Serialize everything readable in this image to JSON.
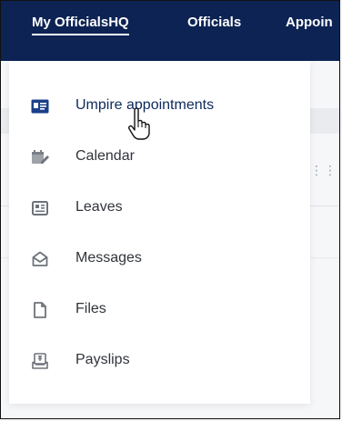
{
  "topnav": {
    "items": [
      {
        "label": "My OfficialsHQ"
      },
      {
        "label": "Officials"
      },
      {
        "label": "Appoin"
      }
    ]
  },
  "menu": {
    "items": [
      {
        "label": "Umpire appointments",
        "icon": "id-card-icon"
      },
      {
        "label": "Calendar",
        "icon": "calendar-edit-icon"
      },
      {
        "label": "Leaves",
        "icon": "newspaper-icon"
      },
      {
        "label": "Messages",
        "icon": "envelope-open-icon"
      },
      {
        "label": "Files",
        "icon": "file-icon"
      },
      {
        "label": "Payslips",
        "icon": "payslip-icon"
      }
    ]
  },
  "colors": {
    "nav_bg": "#0d2354",
    "active_text": "#0d2a5c",
    "icon_active": "#1b3f8a",
    "icon_gray": "#7b8088"
  }
}
